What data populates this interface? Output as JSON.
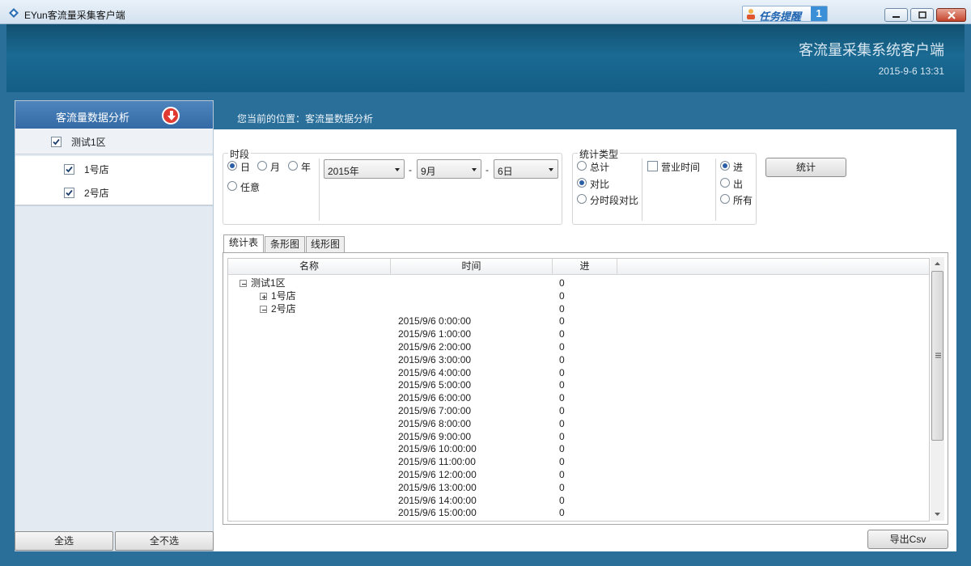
{
  "window": {
    "title": "EYun客流量采集客户端",
    "task_remind_label": "任务提醒",
    "task_remind_count": "1"
  },
  "banner": {
    "system_title": "客流量采集系统客户端",
    "datetime": "2015-9-6 13:31"
  },
  "sidebar": {
    "header": "客流量数据分析",
    "tree": {
      "root": {
        "label": "测试1区",
        "checked": true
      },
      "children": [
        {
          "label": "1号店",
          "checked": true
        },
        {
          "label": "2号店",
          "checked": true
        }
      ]
    },
    "select_all": "全选",
    "select_none": "全不选"
  },
  "breadcrumb": "您当前的位置：客流量数据分析",
  "filters": {
    "period_title": "时段",
    "period_options": [
      "日",
      "月",
      "年",
      "任意"
    ],
    "period_selected": "日",
    "year": "2015年",
    "month": "9月",
    "day": "6日",
    "separator": "-",
    "stat_type_title": "统计类型",
    "stat_types": [
      "总计",
      "对比",
      "分时段对比"
    ],
    "stat_type_selected": "对比",
    "business_hours_label": "营业时间",
    "business_hours_checked": false,
    "direction_options": [
      "进",
      "出",
      "所有"
    ],
    "direction_selected": "进",
    "stat_button": "统计"
  },
  "tabs": [
    "统计表",
    "条形图",
    "线形图"
  ],
  "active_tab": "统计表",
  "table": {
    "columns": [
      "名称",
      "时间",
      "进"
    ],
    "rows": [
      {
        "name": "测试1区",
        "time": "",
        "value": "0",
        "level": 0,
        "expander": "minus"
      },
      {
        "name": "1号店",
        "time": "",
        "value": "0",
        "level": 1,
        "expander": "plus"
      },
      {
        "name": "2号店",
        "time": "",
        "value": "0",
        "level": 1,
        "expander": "minus"
      },
      {
        "name": "",
        "time": "2015/9/6 0:00:00",
        "value": "0",
        "level": 2
      },
      {
        "name": "",
        "time": "2015/9/6 1:00:00",
        "value": "0",
        "level": 2
      },
      {
        "name": "",
        "time": "2015/9/6 2:00:00",
        "value": "0",
        "level": 2
      },
      {
        "name": "",
        "time": "2015/9/6 3:00:00",
        "value": "0",
        "level": 2
      },
      {
        "name": "",
        "time": "2015/9/6 4:00:00",
        "value": "0",
        "level": 2
      },
      {
        "name": "",
        "time": "2015/9/6 5:00:00",
        "value": "0",
        "level": 2
      },
      {
        "name": "",
        "time": "2015/9/6 6:00:00",
        "value": "0",
        "level": 2
      },
      {
        "name": "",
        "time": "2015/9/6 7:00:00",
        "value": "0",
        "level": 2
      },
      {
        "name": "",
        "time": "2015/9/6 8:00:00",
        "value": "0",
        "level": 2
      },
      {
        "name": "",
        "time": "2015/9/6 9:00:00",
        "value": "0",
        "level": 2
      },
      {
        "name": "",
        "time": "2015/9/6 10:00:00",
        "value": "0",
        "level": 2
      },
      {
        "name": "",
        "time": "2015/9/6 11:00:00",
        "value": "0",
        "level": 2
      },
      {
        "name": "",
        "time": "2015/9/6 12:00:00",
        "value": "0",
        "level": 2
      },
      {
        "name": "",
        "time": "2015/9/6 13:00:00",
        "value": "0",
        "level": 2
      },
      {
        "name": "",
        "time": "2015/9/6 14:00:00",
        "value": "0",
        "level": 2
      },
      {
        "name": "",
        "time": "2015/9/6 15:00:00",
        "value": "0",
        "level": 2
      }
    ]
  },
  "export_button": "导出Csv"
}
